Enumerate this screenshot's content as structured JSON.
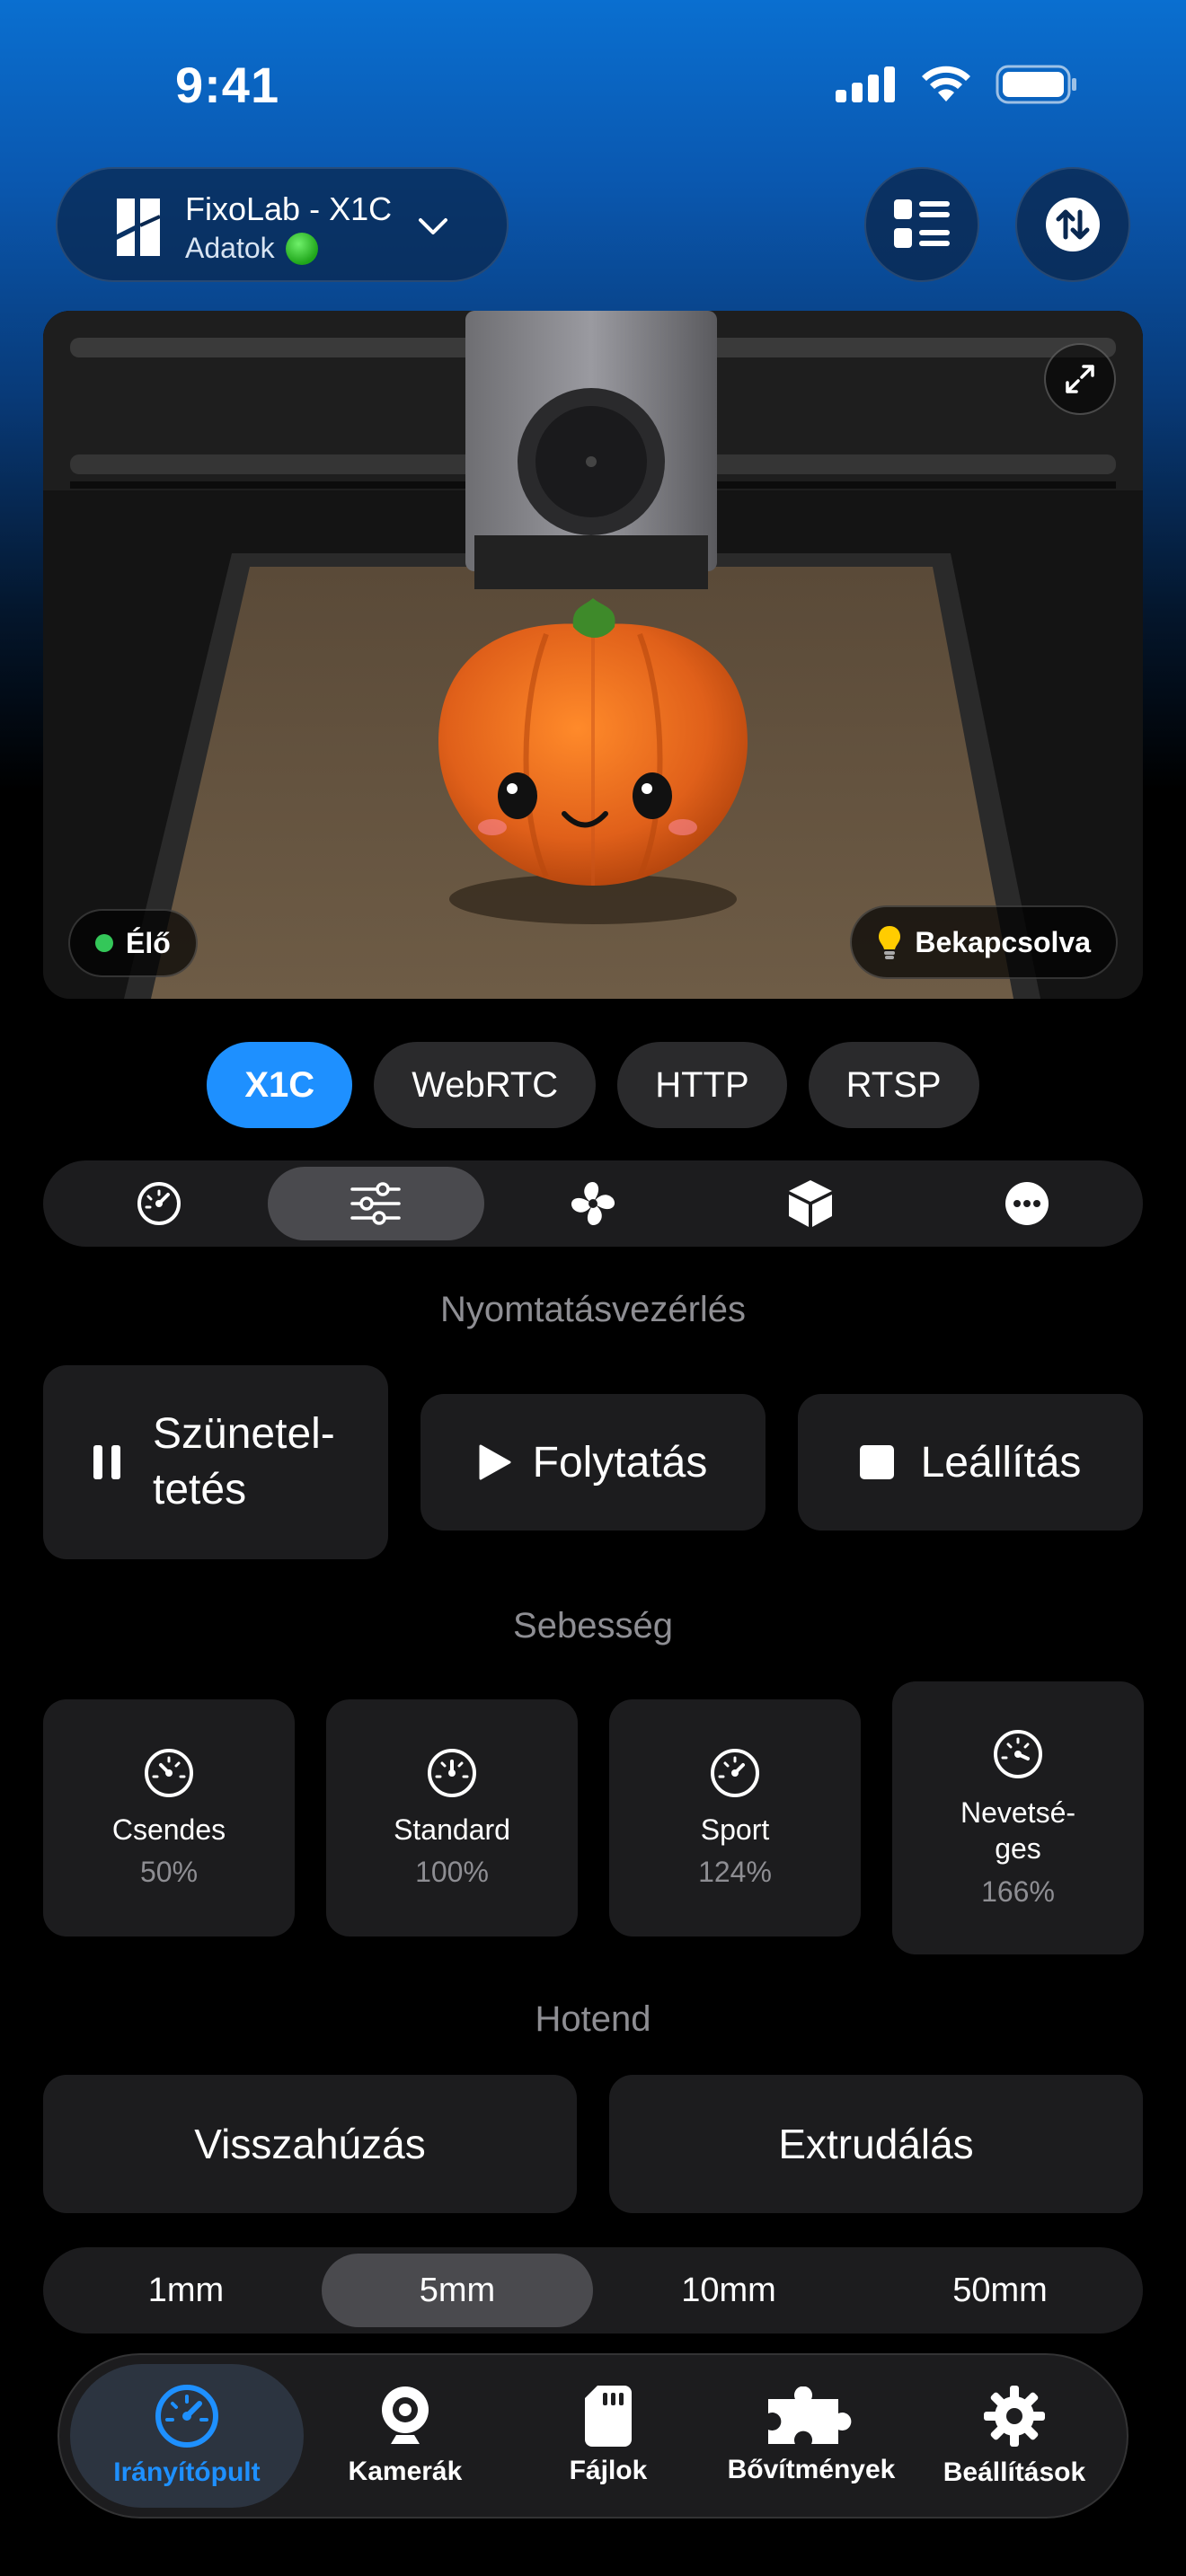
{
  "status_bar": {
    "time": "9:41"
  },
  "header": {
    "printer_name": "FixoLab - X1C",
    "printer_subtitle": "Adatok"
  },
  "camera": {
    "live_label": "Élő",
    "light_label": "Bekapcsolva"
  },
  "source_tabs": [
    "X1C",
    "WebRTC",
    "HTTP",
    "RTSP"
  ],
  "print_control": {
    "title": "Nyomtatásvezérlés",
    "pause_line1": "Szünetel-",
    "pause_line2": "tetés",
    "resume": "Folytatás",
    "stop": "Leállítás"
  },
  "speed": {
    "title": "Sebesség",
    "modes": [
      {
        "name": "Csendes",
        "percent": "50%"
      },
      {
        "name": "Standard",
        "percent": "100%"
      },
      {
        "name": "Sport",
        "percent": "124%"
      },
      {
        "name_line1": "Nevetsé-",
        "name_line2": "ges",
        "percent": "166%"
      }
    ]
  },
  "hotend": {
    "title": "Hotend",
    "retract": "Visszahúzás",
    "extrude": "Extrudálás",
    "distances": [
      "1mm",
      "5mm",
      "10mm",
      "50mm"
    ]
  },
  "tab_bar": {
    "items": [
      "Irányítópult",
      "Kamerák",
      "Fájlok",
      "Bővítmények",
      "Beállítások"
    ]
  },
  "colors": {
    "accent": "#1e90ff",
    "live_dot": "#34c759"
  }
}
